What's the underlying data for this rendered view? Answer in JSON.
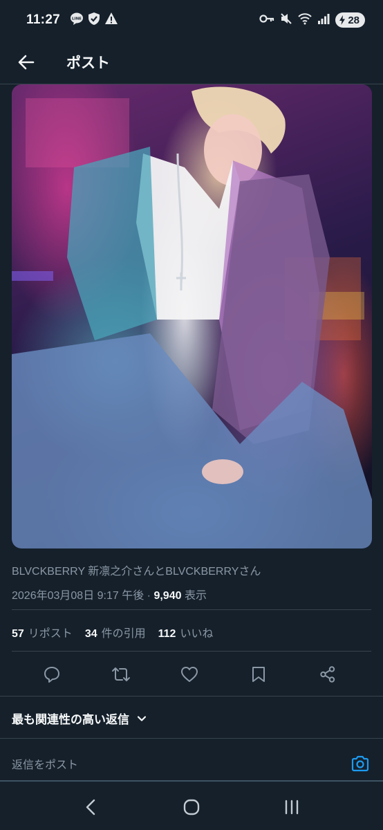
{
  "status_bar": {
    "time": "11:27",
    "battery": "28"
  },
  "header": {
    "title": "ポスト"
  },
  "post": {
    "authors": "BLVCKBERRY 新凛之介さんとBLVCKBERRYさん",
    "date": "2026年03月08日 9:17 午後",
    "separator": " · ",
    "views_count": "9,940",
    "views_label": " 表示"
  },
  "stats": [
    {
      "count": "57",
      "label": "リポスト"
    },
    {
      "count": "34",
      "label": "件の引用"
    },
    {
      "count": "112",
      "label": "いいね"
    }
  ],
  "actions": [
    "reply-icon",
    "retweet-icon",
    "like-icon",
    "bookmark-icon",
    "share-icon"
  ],
  "replies": {
    "sort_label": "最も関連性の高い返信",
    "placeholder": "返信をポスト"
  },
  "colors": {
    "background": "#15202b",
    "accent": "#1d9bf0",
    "secondary_text": "#8b98a5",
    "divider": "#38444d"
  }
}
